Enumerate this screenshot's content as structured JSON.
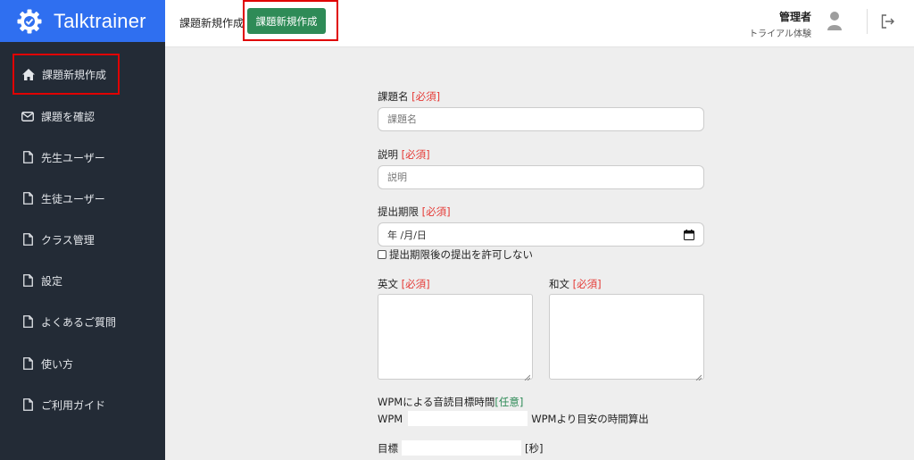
{
  "app": {
    "name": "Talktrainer"
  },
  "sidebar": {
    "items": [
      {
        "label": "課題新規作成",
        "icon": "home-icon"
      },
      {
        "label": "課題を確認",
        "icon": "mail-icon"
      },
      {
        "label": "先生ユーザー",
        "icon": "file-icon"
      },
      {
        "label": "生徒ユーザー",
        "icon": "file-icon"
      },
      {
        "label": "クラス管理",
        "icon": "file-icon"
      },
      {
        "label": "設定",
        "icon": "file-icon"
      },
      {
        "label": "よくあるご質問",
        "icon": "file-icon"
      },
      {
        "label": "使い方",
        "icon": "file-icon"
      },
      {
        "label": "ご利用ガイド",
        "icon": "file-icon"
      }
    ]
  },
  "header": {
    "breadcrumb": "課題新規作成",
    "create_button": "課題新規作成",
    "user_role": "管理者",
    "user_plan": "トライアル体験"
  },
  "form": {
    "title_label": "課題名",
    "title_placeholder": "課題名",
    "desc_label": "説明",
    "desc_placeholder": "説明",
    "deadline_label": "提出期限",
    "deadline_value": "年 /月/日",
    "late_checkbox_label": "提出期限後の提出を許可しない",
    "english_label": "英文",
    "japanese_label": "和文",
    "wpm_section_label": "WPMによる音読目標時間",
    "wpm_prefix": "WPM",
    "wpm_suffix": "WPMより目安の時間算出",
    "target_prefix": "目標",
    "target_suffix": "[秒]",
    "required_tag": "[必須]",
    "optional_tag": "[任意]"
  },
  "colors": {
    "brand": "#2f6ff0",
    "sidebar_bg": "#232b36",
    "create_button": "#2e8b57",
    "required": "#e53935",
    "highlight": "#e00000"
  }
}
